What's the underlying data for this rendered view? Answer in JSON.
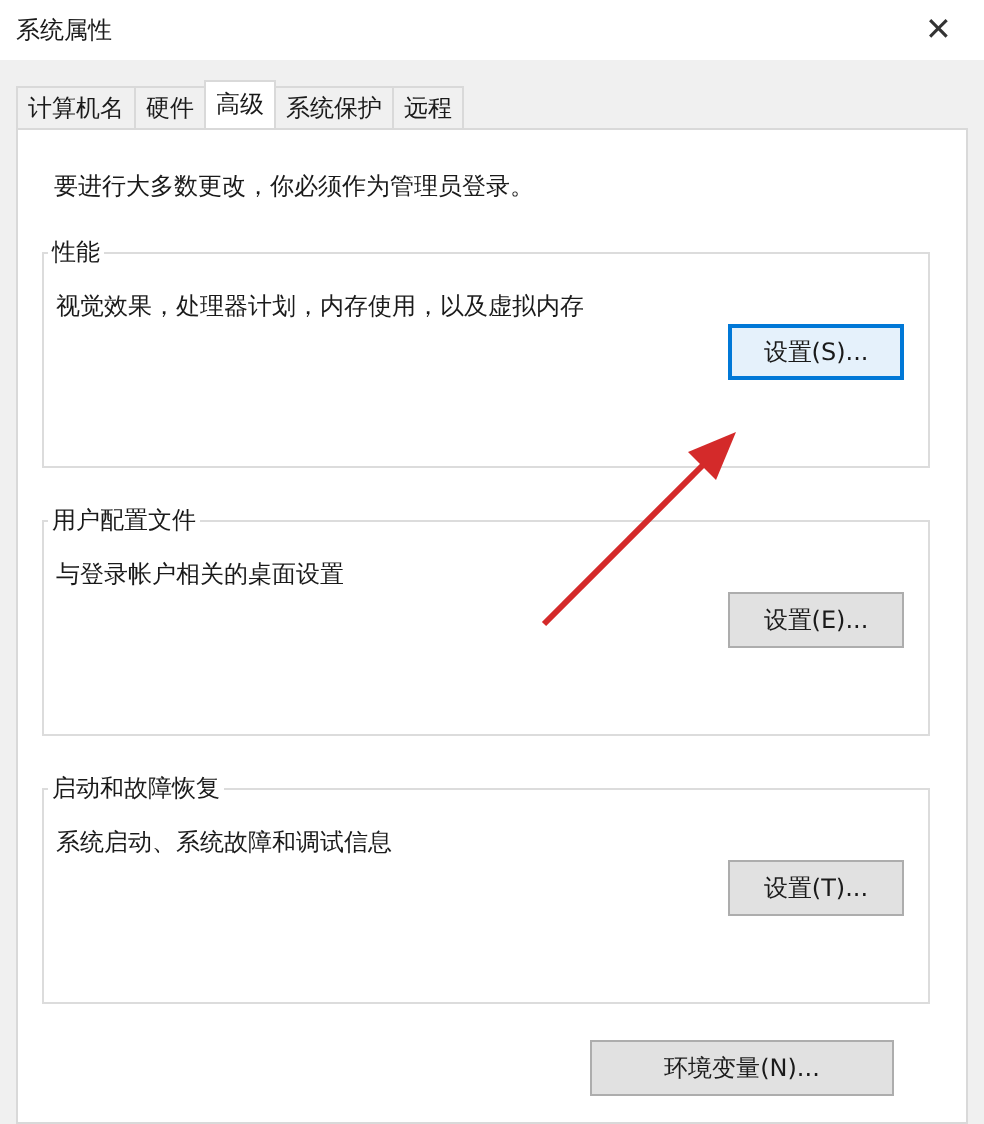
{
  "window": {
    "title": "系统属性",
    "close": "✕"
  },
  "tabs": [
    {
      "label": "计算机名",
      "selected": false
    },
    {
      "label": "硬件",
      "selected": false
    },
    {
      "label": "高级",
      "selected": true
    },
    {
      "label": "系统保护",
      "selected": false
    },
    {
      "label": "远程",
      "selected": false
    }
  ],
  "notice": "要进行大多数更改，你必须作为管理员登录。",
  "groups": [
    {
      "title": "性能",
      "description": "视觉效果，处理器计划，内存使用，以及虚拟内存",
      "button": "设置(S)...",
      "focused": true
    },
    {
      "title": "用户配置文件",
      "description": "与登录帐户相关的桌面设置",
      "button": "设置(E)...",
      "focused": false
    },
    {
      "title": "启动和故障恢复",
      "description": "系统启动、系统故障和调试信息",
      "button": "设置(T)...",
      "focused": false
    }
  ],
  "bottom_button": "环境变量(N)...",
  "annotation": {
    "kind": "arrow",
    "color": "#d42a2a"
  }
}
